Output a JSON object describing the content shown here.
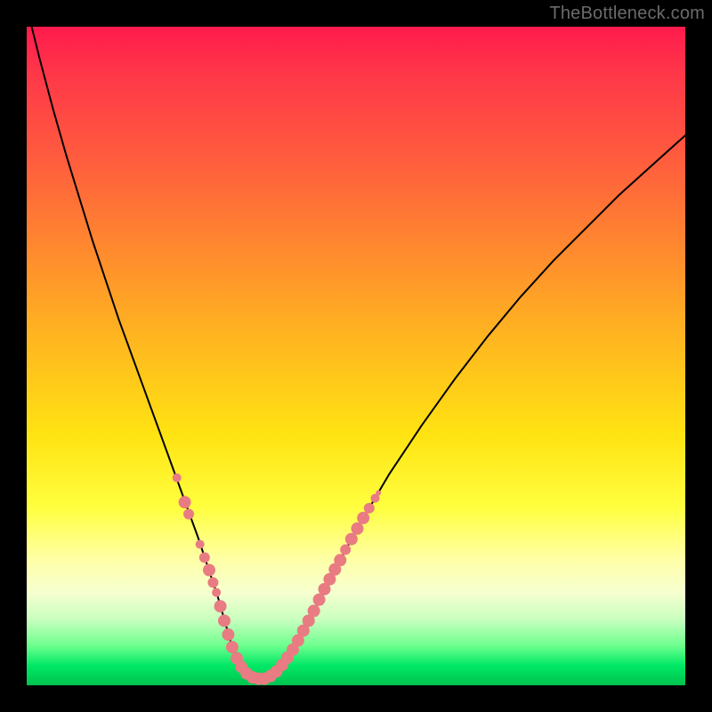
{
  "watermark": "TheBottleneck.com",
  "colors": {
    "frame": "#000000",
    "curve_stroke": "#000000",
    "marker_fill": "#e97b82",
    "marker_stroke": "#c65c66"
  },
  "chart_data": {
    "type": "line",
    "title": "",
    "xlabel": "",
    "ylabel": "",
    "xlim": [
      0,
      100
    ],
    "ylim": [
      0,
      100
    ],
    "grid": false,
    "legend": false,
    "series": [
      {
        "name": "curve",
        "x": [
          0,
          2,
          4,
          6,
          8,
          10,
          12,
          14,
          16,
          18,
          20,
          22,
          24,
          26,
          28,
          29,
          30,
          31,
          32,
          33,
          34,
          36,
          38,
          40,
          42,
          44,
          46,
          50,
          55,
          60,
          65,
          70,
          75,
          80,
          85,
          90,
          95,
          100
        ],
        "y": [
          103,
          95,
          87.5,
          80.5,
          74,
          67.5,
          61.5,
          55.5,
          50,
          44.5,
          39,
          33.5,
          28,
          22.5,
          16.5,
          13.5,
          10,
          6.5,
          4,
          2,
          1.2,
          1,
          2,
          4.5,
          8,
          12,
          16,
          23.5,
          32,
          39.5,
          46.5,
          53,
          59,
          64.5,
          69.5,
          74.5,
          79,
          83.5
        ]
      }
    ],
    "markers": {
      "left_branch": [
        {
          "x": 22.8,
          "y": 31.5,
          "r": 5
        },
        {
          "x": 24.0,
          "y": 27.8,
          "r": 7
        },
        {
          "x": 24.6,
          "y": 26.0,
          "r": 6
        },
        {
          "x": 26.3,
          "y": 21.4,
          "r": 5
        },
        {
          "x": 27.0,
          "y": 19.4,
          "r": 6
        },
        {
          "x": 27.7,
          "y": 17.5,
          "r": 7
        },
        {
          "x": 28.3,
          "y": 15.6,
          "r": 6
        },
        {
          "x": 28.8,
          "y": 14.1,
          "r": 5
        },
        {
          "x": 29.4,
          "y": 12.0,
          "r": 7
        },
        {
          "x": 30.0,
          "y": 9.8,
          "r": 7
        },
        {
          "x": 30.6,
          "y": 7.7,
          "r": 7
        },
        {
          "x": 31.2,
          "y": 5.8,
          "r": 7
        },
        {
          "x": 31.9,
          "y": 4.1,
          "r": 7
        },
        {
          "x": 32.6,
          "y": 2.8,
          "r": 7
        }
      ],
      "bottom": [
        {
          "x": 33.4,
          "y": 1.8,
          "r": 7
        },
        {
          "x": 34.3,
          "y": 1.2,
          "r": 7
        },
        {
          "x": 35.2,
          "y": 1.0,
          "r": 7
        },
        {
          "x": 36.1,
          "y": 1.0,
          "r": 7
        },
        {
          "x": 37.0,
          "y": 1.4,
          "r": 7
        },
        {
          "x": 37.9,
          "y": 2.1,
          "r": 7
        }
      ],
      "right_branch": [
        {
          "x": 38.8,
          "y": 3.1,
          "r": 7
        },
        {
          "x": 39.6,
          "y": 4.2,
          "r": 7
        },
        {
          "x": 40.4,
          "y": 5.4,
          "r": 7
        },
        {
          "x": 41.2,
          "y": 6.8,
          "r": 7
        },
        {
          "x": 42.0,
          "y": 8.3,
          "r": 7
        },
        {
          "x": 42.8,
          "y": 9.8,
          "r": 7
        },
        {
          "x": 43.6,
          "y": 11.3,
          "r": 7
        },
        {
          "x": 44.4,
          "y": 13.0,
          "r": 7
        },
        {
          "x": 45.2,
          "y": 14.6,
          "r": 7
        },
        {
          "x": 46.0,
          "y": 16.1,
          "r": 7
        },
        {
          "x": 46.8,
          "y": 17.6,
          "r": 7
        },
        {
          "x": 47.6,
          "y": 19.0,
          "r": 7
        },
        {
          "x": 48.4,
          "y": 20.6,
          "r": 6
        },
        {
          "x": 49.3,
          "y": 22.2,
          "r": 7
        },
        {
          "x": 50.2,
          "y": 23.8,
          "r": 7
        },
        {
          "x": 51.1,
          "y": 25.4,
          "r": 7
        },
        {
          "x": 52.0,
          "y": 26.9,
          "r": 6
        },
        {
          "x": 52.9,
          "y": 28.4,
          "r": 5
        },
        {
          "x": 53.4,
          "y": 29.2,
          "r": 3
        }
      ]
    }
  }
}
